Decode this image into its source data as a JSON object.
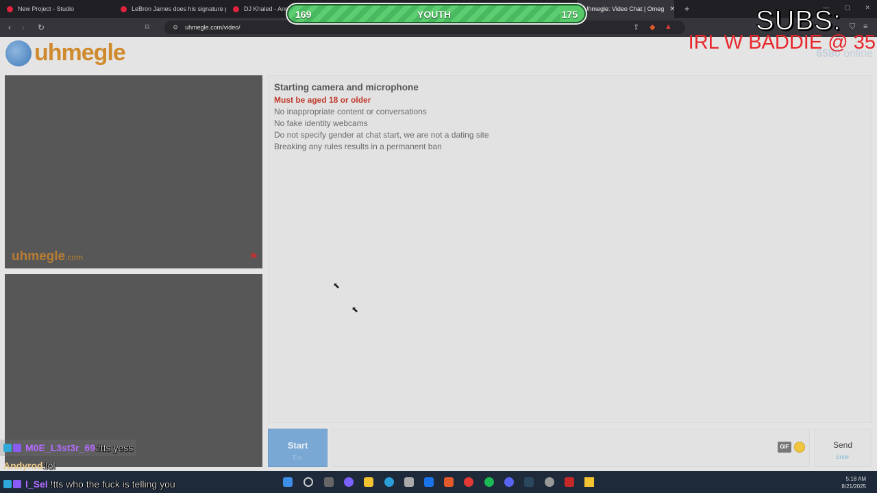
{
  "browser": {
    "tabs": [
      {
        "label": "New Project - Studio",
        "color": "#e0243b",
        "active": false
      },
      {
        "label": "LeBron James does his signature pre-",
        "color": "#e0243b",
        "active": false
      },
      {
        "label": "DJ Khaled - Anoth",
        "color": "#e0243b",
        "active": false
      },
      {
        "label": "Uhmegle: Video Chat | Omeg",
        "color": "#4a7ab8",
        "active": true
      }
    ],
    "url": "uhmegle.com/video/"
  },
  "overlay": {
    "left_value": "169",
    "center_label": "YOUTH",
    "right_value": "175",
    "progress_fraction": 0.92,
    "subs_text": "SUBS:",
    "goal_text": "IRL W BADDIE @ 35"
  },
  "site": {
    "logo_text": "uhmegle",
    "online_count": "6580",
    "online_label": "online",
    "watermark_main": "uhmegle",
    "watermark_tld": ".com"
  },
  "chatlog": {
    "heading": "Starting camera and microphone",
    "rule_red": "Must be aged 18 or older",
    "rules": [
      "No inappropriate content or conversations",
      "No fake identity webcams",
      "Do not specify gender at chat start, we are not a dating site",
      "Breaking any rules results in a permanent ban"
    ]
  },
  "controls": {
    "start_label": "Start",
    "start_sub": "Esc",
    "gif_label": "GIF",
    "send_label": "Send",
    "send_sub": "Enter"
  },
  "stream_chat": [
    {
      "user": "M0E_L3st3r_69",
      "sep": " : ",
      "text": "!tts yess",
      "user_color": "#b36bff"
    },
    {
      "user": "Andyrod",
      "sep": " : ",
      "text": "lol",
      "user_color": "#e8c98a"
    },
    {
      "user": "l_Sel",
      "sep": " : ",
      "text": "!tts who the fuck is telling you",
      "user_color": "#b36bff"
    }
  ],
  "taskbar": {
    "time": "5:18 AM",
    "date": "8/21/2025"
  }
}
